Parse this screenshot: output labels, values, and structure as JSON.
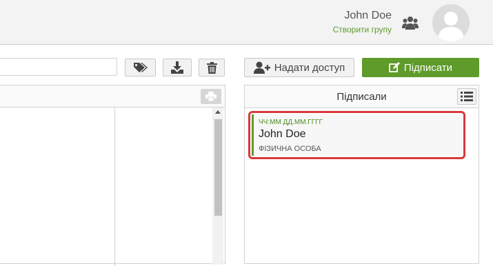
{
  "header": {
    "user_name": "John Doe",
    "create_group_label": "Створити групу"
  },
  "toolbar": {
    "search_value": "",
    "share_label": "Надати доступ",
    "sign_label": "Підписати"
  },
  "signers": {
    "title": "Підписали",
    "items": [
      {
        "timestamp": "ЧЧ:ММ ДД.ММ.ГГГГ",
        "name": "John Doe",
        "type": "ФІЗИЧНА ОСОБА"
      }
    ]
  },
  "colors": {
    "accent_green": "#5e9b2a",
    "highlight_red": "#d9383a"
  }
}
